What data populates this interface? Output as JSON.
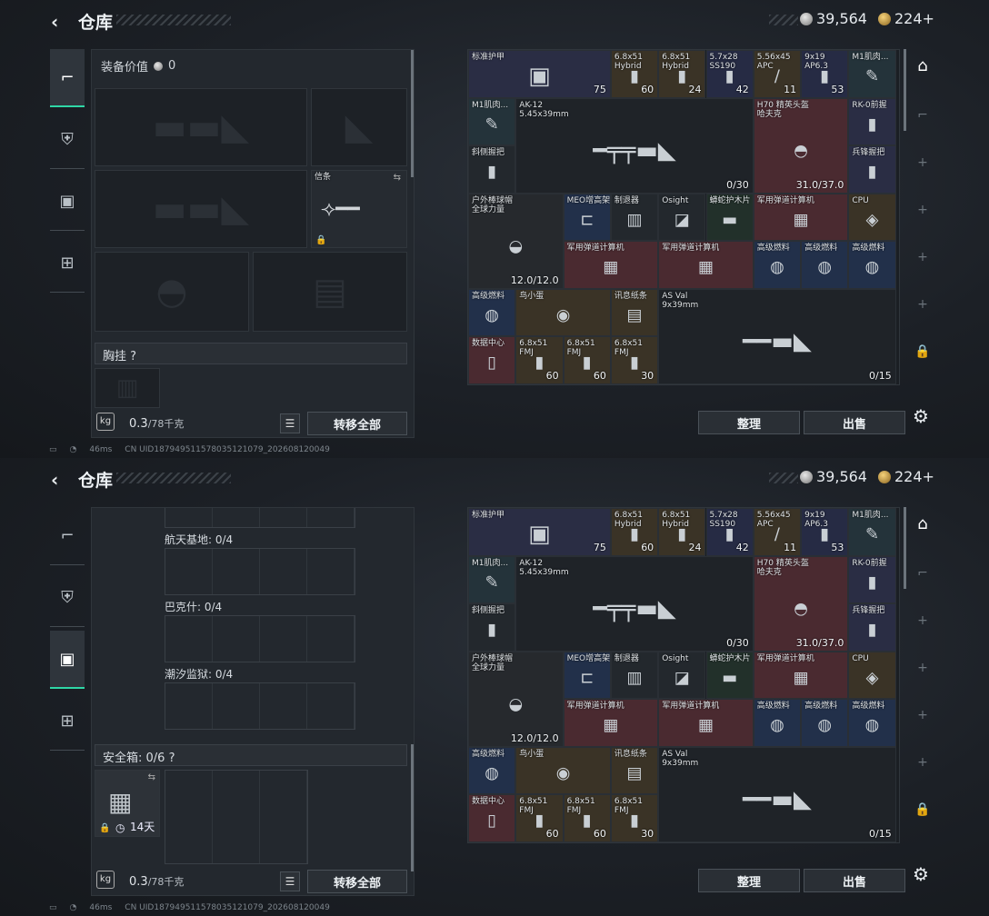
{
  "header": {
    "back_icon": "‹",
    "title": "仓库",
    "silver": "39,564",
    "gold": "224+"
  },
  "equipment": {
    "label": "装备价值",
    "value": "0",
    "knife_label": "信条",
    "chest_label": "胸挂",
    "help": "?"
  },
  "storage": {
    "sections": [
      {
        "label": "航天基地: 0/4"
      },
      {
        "label": "巴克什: 0/4"
      },
      {
        "label": "潮汐监狱: 0/4"
      }
    ],
    "safe_label": "安全箱: 0/6",
    "safe_time": "14天"
  },
  "footer": {
    "weight": "0.3",
    "weight_cap": "/78千克",
    "transfer_all": "转移全部",
    "sort": "整理",
    "sell": "出售"
  },
  "status": {
    "ping": "46ms",
    "uid": "CN UID18794951157803512107​9_202608120049"
  },
  "items": [
    {
      "name": "标准护甲",
      "count": "75"
    },
    {
      "name": "6.8x51\nHybrid",
      "count": "60"
    },
    {
      "name": "6.8x51\nHybrid",
      "count": "24"
    },
    {
      "name": "5.7x28\nSS190",
      "count": "42"
    },
    {
      "name": "5.56x45\nAPC",
      "count": "11"
    },
    {
      "name": "9x19\nAP6.3",
      "count": "53"
    },
    {
      "name": "M1肌肉...",
      "count": ""
    },
    {
      "name": "M1肌肉...",
      "count": ""
    },
    {
      "name": "AK-12\n5.45x39mm",
      "count": "0/30"
    },
    {
      "name": "H70 精英头盔\n哈夫克",
      "count": "31.0/37.0"
    },
    {
      "name": "RK-0前握",
      "count": ""
    },
    {
      "name": "斜侧握把",
      "count": ""
    },
    {
      "name": "兵锋握把",
      "count": ""
    },
    {
      "name": "户外棒球帽\n全球力量",
      "count": "12.0/12.0"
    },
    {
      "name": "MEO增高架",
      "count": ""
    },
    {
      "name": "制退器",
      "count": ""
    },
    {
      "name": "Osight",
      "count": ""
    },
    {
      "name": "蟒蛇护木片",
      "count": ""
    },
    {
      "name": "军用弹道计算机",
      "count": ""
    },
    {
      "name": "CPU",
      "count": ""
    },
    {
      "name": "军用弹道计算机",
      "count": ""
    },
    {
      "name": "军用弹道计算机",
      "count": ""
    },
    {
      "name": "高级燃料",
      "count": ""
    },
    {
      "name": "高级燃料",
      "count": ""
    },
    {
      "name": "高级燃料",
      "count": ""
    },
    {
      "name": "高级燃料",
      "count": ""
    },
    {
      "name": "鸟小蛋",
      "count": ""
    },
    {
      "name": "讯息纸条",
      "count": ""
    },
    {
      "name": "AS Val\n9x39mm",
      "count": "0/15"
    },
    {
      "name": "数据中心",
      "count": ""
    },
    {
      "name": "6.8x51\nFMJ",
      "count": "60"
    },
    {
      "name": "6.8x51\nFMJ",
      "count": "60"
    },
    {
      "name": "6.8x51\nFMJ",
      "count": "30"
    }
  ]
}
